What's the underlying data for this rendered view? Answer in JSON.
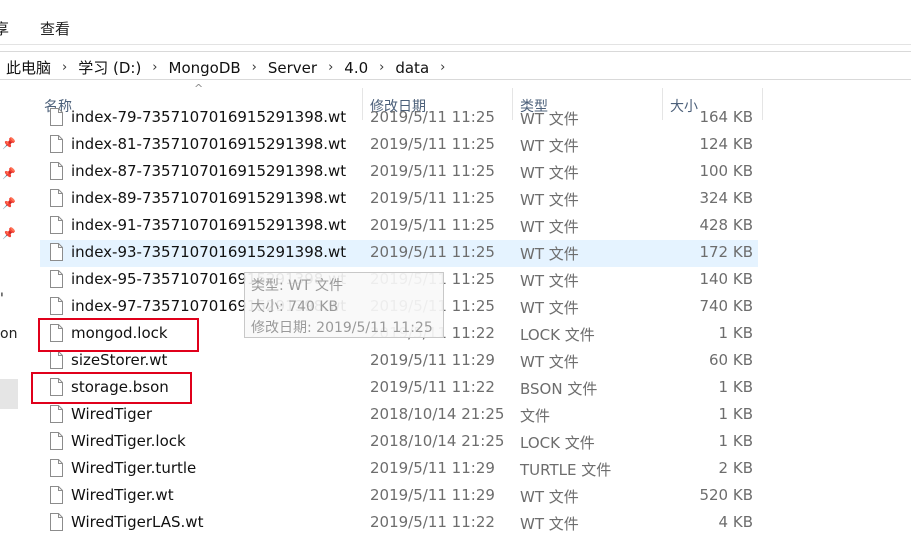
{
  "ribbon": {
    "tabs": [
      "享",
      "查看"
    ]
  },
  "address": {
    "crumbs": [
      "此电脑",
      "学习 (D:)",
      "MongoDB",
      "Server",
      "4.0",
      "data"
    ]
  },
  "navpane": {
    "partial_label": "on",
    "second_partial": "'"
  },
  "columns": {
    "name": "名称",
    "date": "修改日期",
    "type": "类型",
    "size": "大小"
  },
  "files": [
    {
      "name": "index-79-7357107016915291398.wt",
      "date": "2019/5/11 11:25",
      "type": "WT 文件",
      "size": "164 KB"
    },
    {
      "name": "index-81-7357107016915291398.wt",
      "date": "2019/5/11 11:25",
      "type": "WT 文件",
      "size": "124 KB"
    },
    {
      "name": "index-87-7357107016915291398.wt",
      "date": "2019/5/11 11:25",
      "type": "WT 文件",
      "size": "100 KB"
    },
    {
      "name": "index-89-7357107016915291398.wt",
      "date": "2019/5/11 11:25",
      "type": "WT 文件",
      "size": "324 KB"
    },
    {
      "name": "index-91-7357107016915291398.wt",
      "date": "2019/5/11 11:25",
      "type": "WT 文件",
      "size": "428 KB"
    },
    {
      "name": "index-93-7357107016915291398.wt",
      "date": "2019/5/11 11:25",
      "type": "WT 文件",
      "size": "172 KB"
    },
    {
      "name": "index-95-7357107016915291398.wt",
      "date": "2019/5/11 11:25",
      "type": "WT 文件",
      "size": "140 KB"
    },
    {
      "name": "index-97-7357107016915291398.wt",
      "date": "2019/5/11 11:25",
      "type": "WT 文件",
      "size": "740 KB"
    },
    {
      "name": "mongod.lock",
      "date": "2019/5/11 11:22",
      "type": "LOCK 文件",
      "size": "1 KB"
    },
    {
      "name": "sizeStorer.wt",
      "date": "2019/5/11 11:29",
      "type": "WT 文件",
      "size": "60 KB"
    },
    {
      "name": "storage.bson",
      "date": "2019/5/11 11:22",
      "type": "BSON 文件",
      "size": "1 KB"
    },
    {
      "name": "WiredTiger",
      "date": "2018/10/14 21:25",
      "type": "文件",
      "size": "1 KB"
    },
    {
      "name": "WiredTiger.lock",
      "date": "2018/10/14 21:25",
      "type": "LOCK 文件",
      "size": "1 KB"
    },
    {
      "name": "WiredTiger.turtle",
      "date": "2019/5/11 11:29",
      "type": "TURTLE 文件",
      "size": "2 KB"
    },
    {
      "name": "WiredTiger.wt",
      "date": "2019/5/11 11:29",
      "type": "WT 文件",
      "size": "520 KB"
    },
    {
      "name": "WiredTigerLAS.wt",
      "date": "2019/5/11 11:22",
      "type": "WT 文件",
      "size": "4 KB"
    }
  ],
  "tooltip": {
    "line1": "类型: WT 文件",
    "line2": "大小: 740 KB",
    "line3": "修改日期: 2019/5/11 11:25"
  },
  "colors": {
    "highlight": "#e5f3ff",
    "annotation": "#e0001b",
    "header_text": "#4c607a"
  }
}
